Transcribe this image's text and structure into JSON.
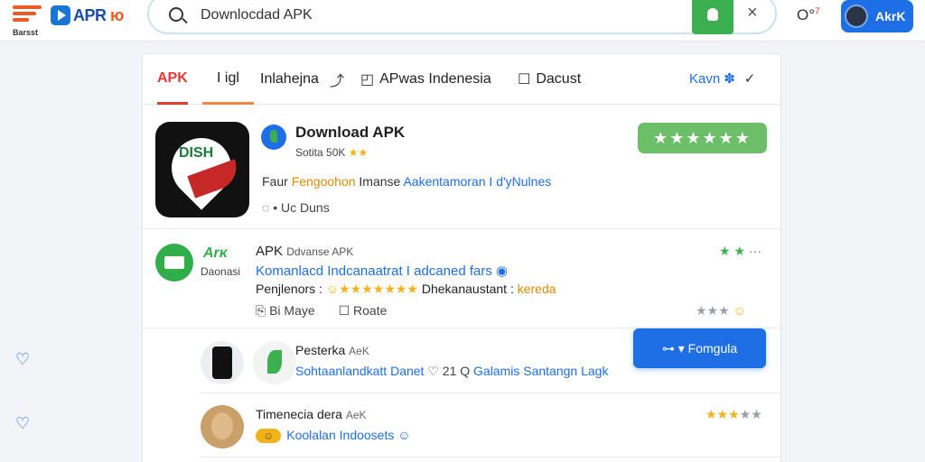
{
  "brand": {
    "sub_label": "Barsst",
    "logo_text_main": "APR",
    "logo_text_accent": "ю"
  },
  "search": {
    "value": "Downlocdad APK",
    "clear_label": "×"
  },
  "header": {
    "user_label": "O°",
    "account_label": "AkrK"
  },
  "tabs": [
    {
      "label": "APK",
      "icon": ""
    },
    {
      "label": "I igl",
      "icon": ""
    },
    {
      "label": "Inlahejna",
      "icon": "share-icon"
    },
    {
      "label": "APwas Indenesia",
      "icon": "camera-icon"
    },
    {
      "label": "Dacust",
      "icon": "square-icon"
    }
  ],
  "tab_right": {
    "label": "Kavn",
    "icon": "gear-icon"
  },
  "app": {
    "title": "Download APK",
    "sub": "Sotita 50K",
    "sub_stars": "★★",
    "desc_prefix": "Faur",
    "desc_hl": "Fengoohon",
    "desc_mid": "Imanse",
    "desc_blue": "Aakentamoran I d'yNulnes",
    "meta": "• Uc Duns",
    "rating": "★★★★★★",
    "icon_text": "DISH"
  },
  "row1": {
    "brand": "Arκ",
    "brand_sub": "Daonasi",
    "title": "APK",
    "title_small": "Ddvanse APK",
    "link": "Komanlacd Indcanaatrat I adcaned fars ◉",
    "line3_a": "Penjlenors :",
    "line3_stars": "☺★★★★★★★",
    "line3_b": "Dhekanaustant :",
    "line3_c": "kereda",
    "meta_a": "Bi Maye",
    "meta_b": "Roate",
    "stars_top": "★ ★",
    "stars_bottom": "★★★",
    "stars_bottom_emo": "☺"
  },
  "row2": {
    "title": "Pesterka",
    "title_small": "AeK",
    "sub_a": "Sohtaanlandkatt Danet",
    "sub_b": "♡ 21 Q",
    "sub_c": "Galamis Santangn Lagk",
    "button": "Fomgula"
  },
  "row3": {
    "title": "Timenecia dera",
    "title_small": "AeK",
    "chip": "☺",
    "sub": "Koolalan Indoosets",
    "sub_emo": "☺",
    "stars": "★★★",
    "stars_off": "★★"
  },
  "colors": {
    "accent": "#1e6fe6",
    "brand": "#f05a22",
    "success": "#3caf50",
    "star": "#f2b21a"
  }
}
